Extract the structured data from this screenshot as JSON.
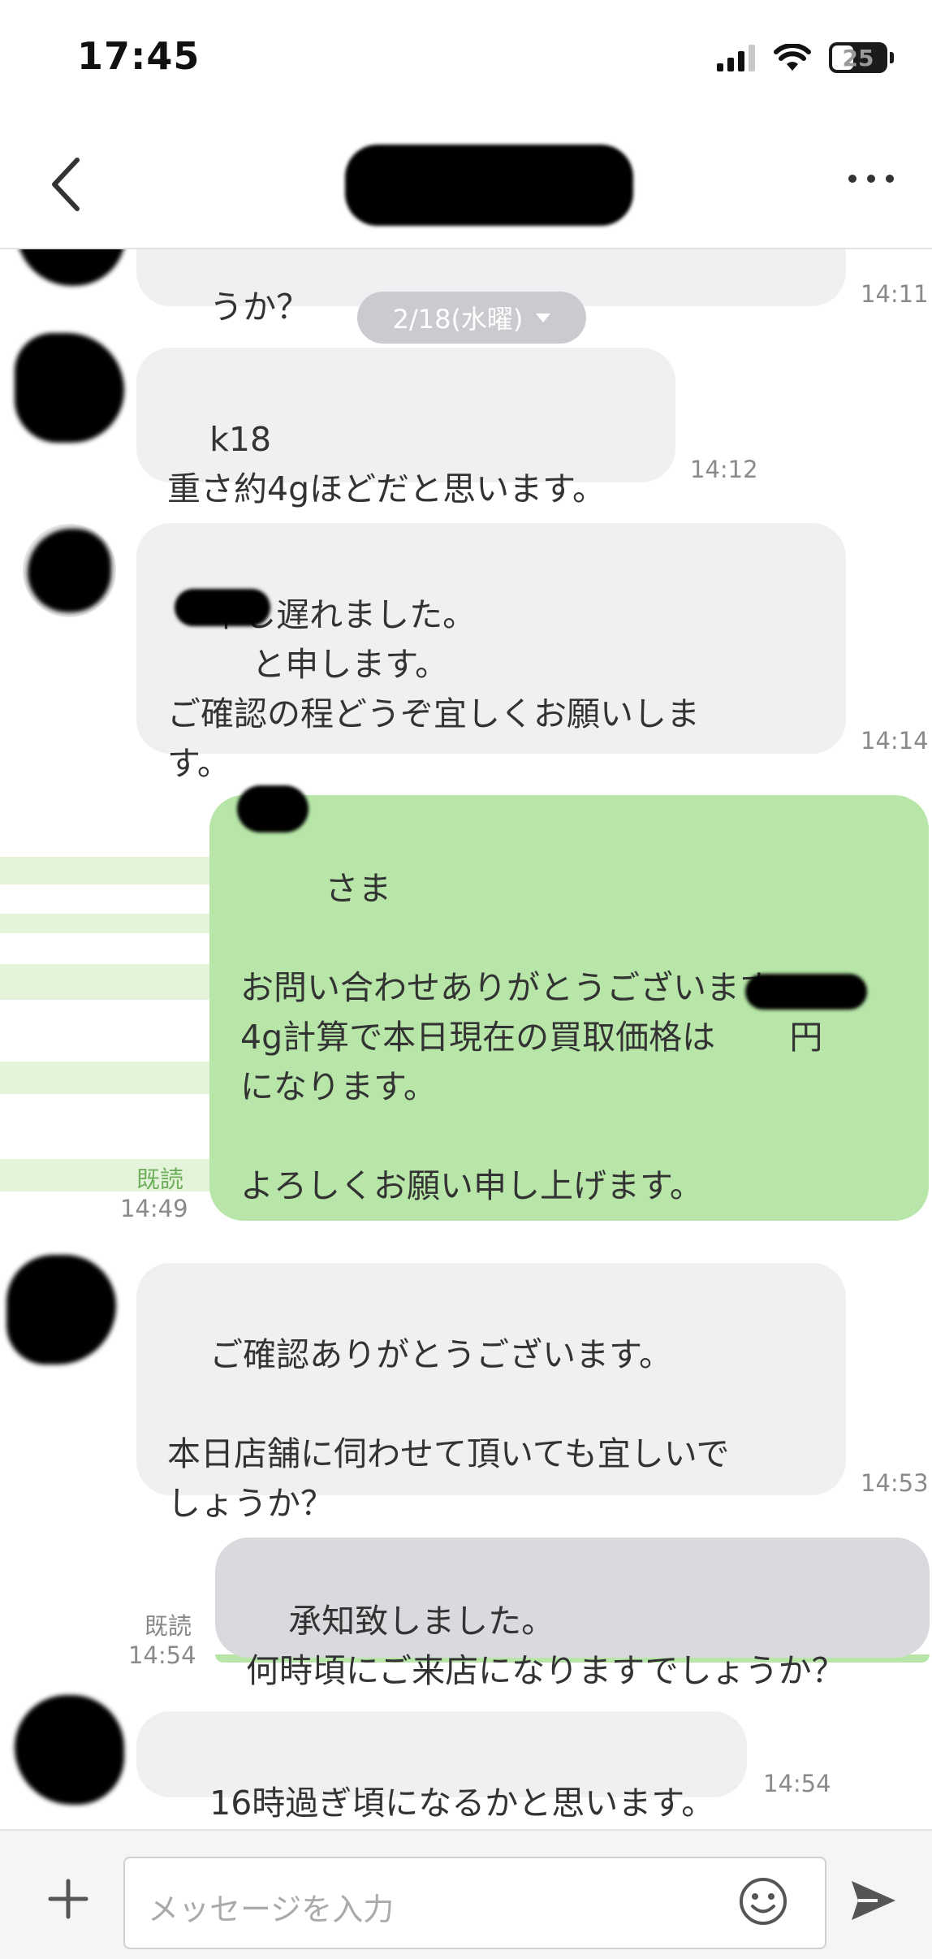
{
  "status_bar": {
    "time": "17:45",
    "battery": "25"
  },
  "header": {
    "back_label": "<",
    "more_label": "..."
  },
  "date_chip": "2/18(水曜)",
  "messages": [
    {
      "side": "in",
      "text": "うか？",
      "time": "14:11"
    },
    {
      "side": "in",
      "text": "k18\n重さ約4gほどだと思います。",
      "time": "14:12"
    },
    {
      "side": "in",
      "text": "申し遅れました。\n        と申します。\nご確認の程どうぞ宜しくお願いしま\nす。",
      "time": "14:14"
    },
    {
      "side": "out",
      "text": "    さま\n\nお問い合わせありがとうございます。\n4g計算で本日現在の買取価格は       円\nになります。\n\nよろしくお願い申し上げます。",
      "read": "既読",
      "time": "14:49"
    },
    {
      "side": "in",
      "text": "ご確認ありがとうございます。\n\n本日店舗に伺わせて頂いても宜しいで\nしょうか？",
      "time": "14:53"
    },
    {
      "side": "out",
      "text": "承知致しました。\n何時頃にご来店になりますでしょうか？",
      "read": "既読",
      "time": "14:54"
    },
    {
      "side": "in",
      "text": "16時過ぎ頃になるかと思います。",
      "time": "14:54"
    }
  ],
  "input_bar": {
    "placeholder": "メッセージを入力"
  },
  "colors": {
    "incoming_bubble": "#eef0f2",
    "outgoing_bubble": "#b7e6a8",
    "read_label": "#6fae5b"
  },
  "icons": [
    "back-chevron-icon",
    "more-icon",
    "plus-icon",
    "smile-icon",
    "send-icon",
    "signal-icon",
    "wifi-icon",
    "battery-icon"
  ]
}
